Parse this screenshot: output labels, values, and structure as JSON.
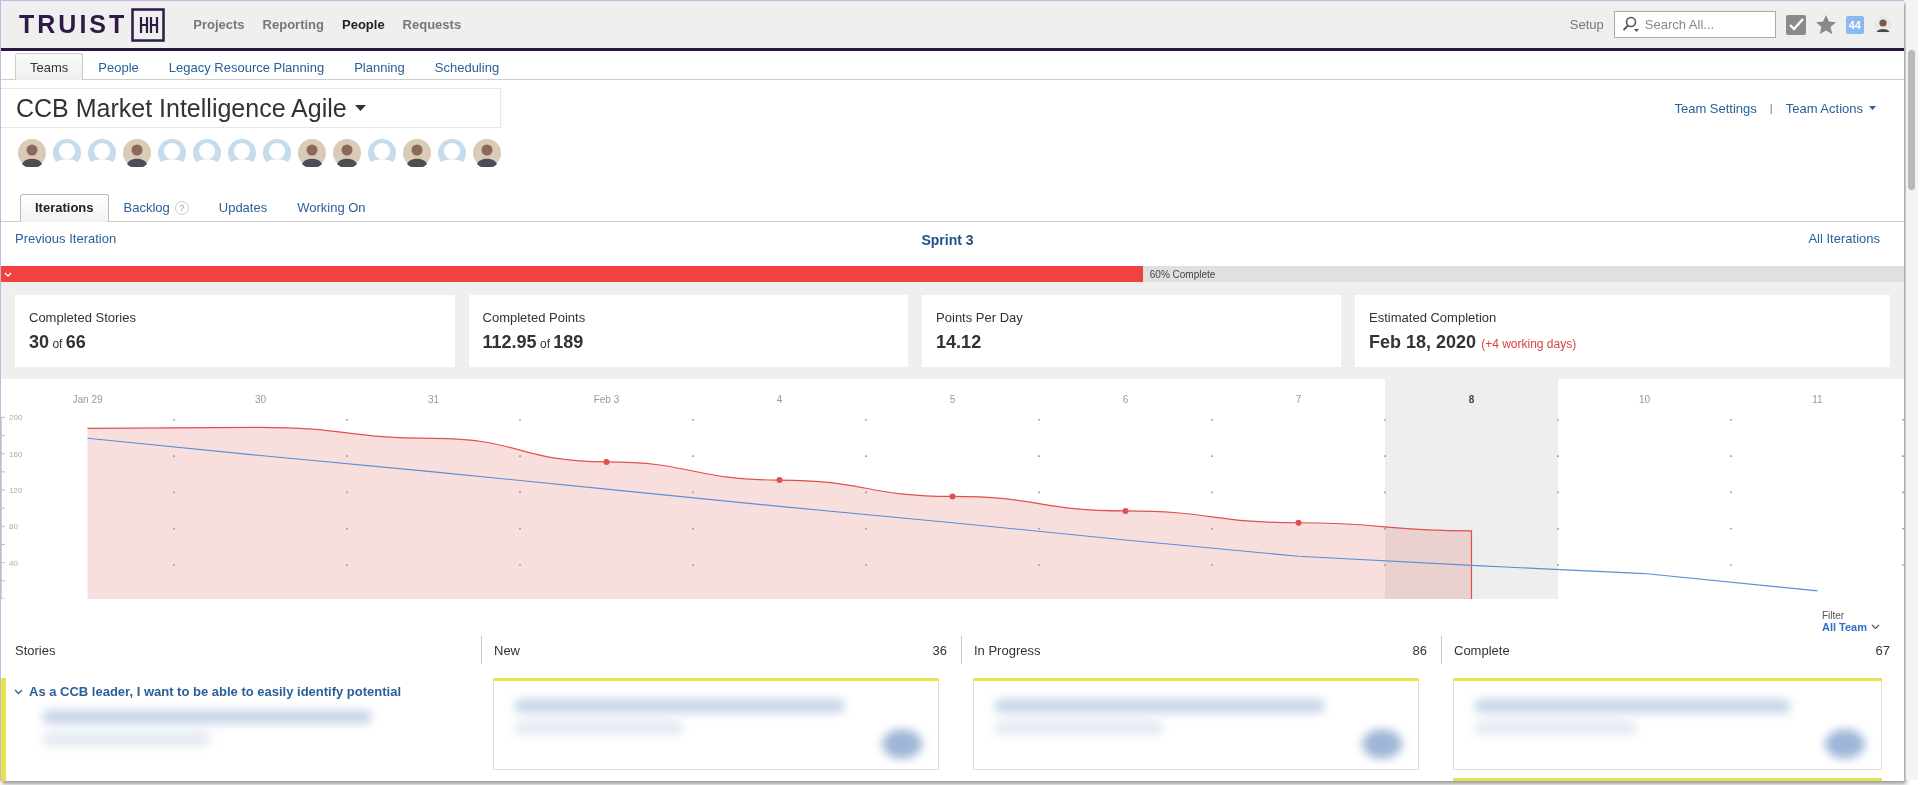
{
  "header": {
    "logo_text": "TRUIST",
    "nav": [
      {
        "label": "Projects",
        "selected": false
      },
      {
        "label": "Reporting",
        "selected": false
      },
      {
        "label": "People",
        "selected": true
      },
      {
        "label": "Requests",
        "selected": false
      }
    ],
    "setup": "Setup",
    "search": {
      "placeholder": "Search All..."
    },
    "notification_count": "44"
  },
  "subnav": [
    {
      "label": "Teams",
      "selected": true
    },
    {
      "label": "People",
      "selected": false
    },
    {
      "label": "Legacy Resource Planning",
      "selected": false
    },
    {
      "label": "Planning",
      "selected": false
    },
    {
      "label": "Scheduling",
      "selected": false
    }
  ],
  "team": {
    "title": "CCB Market Intelligence Agile",
    "settings_link": "Team Settings",
    "separator": "|",
    "actions_link": "Team Actions",
    "members": [
      {
        "kind": "photo"
      },
      {
        "kind": "placeholder"
      },
      {
        "kind": "placeholder"
      },
      {
        "kind": "photo"
      },
      {
        "kind": "placeholder"
      },
      {
        "kind": "placeholder"
      },
      {
        "kind": "placeholder"
      },
      {
        "kind": "placeholder"
      },
      {
        "kind": "photo"
      },
      {
        "kind": "photo"
      },
      {
        "kind": "placeholder"
      },
      {
        "kind": "photo"
      },
      {
        "kind": "placeholder"
      },
      {
        "kind": "photo"
      }
    ]
  },
  "team_tabs": [
    {
      "label": "Iterations",
      "selected": true
    },
    {
      "label": "Backlog",
      "selected": false,
      "help": "?"
    },
    {
      "label": "Updates",
      "selected": false
    },
    {
      "label": "Working On",
      "selected": false
    }
  ],
  "iteration": {
    "previous": "Previous Iteration",
    "title": "Sprint 3",
    "all": "All Iterations",
    "progress": {
      "level": 0.6,
      "label": "60% Complete"
    }
  },
  "stats": [
    {
      "label": "Completed Stories",
      "value": "30",
      "connector": "of",
      "total": "66"
    },
    {
      "label": "Completed Points",
      "value": "112.95",
      "connector": "of",
      "total": "189"
    },
    {
      "label": "Points Per Day",
      "value": "14.12"
    },
    {
      "label": "Estimated Completion",
      "value": "Feb 18, 2020",
      "note": "(+4 working days)"
    }
  ],
  "burndown": {
    "chart_data": {
      "type": "area",
      "categories": [
        "Jan 29",
        "30",
        "31",
        "Feb 3",
        "4",
        "5",
        "6",
        "7",
        "8",
        "10",
        "11"
      ],
      "ylim": [
        0,
        200
      ],
      "yticks": [
        40,
        80,
        120,
        160,
        200
      ],
      "series": [
        {
          "color": "#e0504f",
          "values": [
            188,
            189,
            177,
            151,
            131,
            113,
            97,
            84,
            75,
            null,
            null
          ]
        },
        {
          "type": "line",
          "color": "#5b8fd6",
          "values": [
            177,
            158,
            140,
            121,
            102,
            84,
            65,
            47,
            37,
            28,
            9
          ]
        }
      ],
      "bands": [
        {
          "axis": "x",
          "from": "8",
          "to": "8",
          "color": "#eeeeee"
        }
      ]
    }
  },
  "board": {
    "filter_label": "Filter",
    "filter_value": "All Team",
    "columns": [
      {
        "title": "Stories",
        "story": {
          "title": "As a CCB leader, I want to be able to easily identify potential",
          "expanded": true,
          "details": {
            "kind": "blurred"
          }
        }
      },
      {
        "title": "New",
        "count": "36",
        "cards": [
          {
            "kind": "blurred"
          }
        ]
      },
      {
        "title": "In Progress",
        "count": "86",
        "cards": [
          {
            "kind": "blurred"
          }
        ]
      },
      {
        "title": "Complete",
        "count": "67",
        "cards": [
          {
            "kind": "blurred"
          },
          {
            "kind": "blurred"
          }
        ]
      }
    ]
  }
}
